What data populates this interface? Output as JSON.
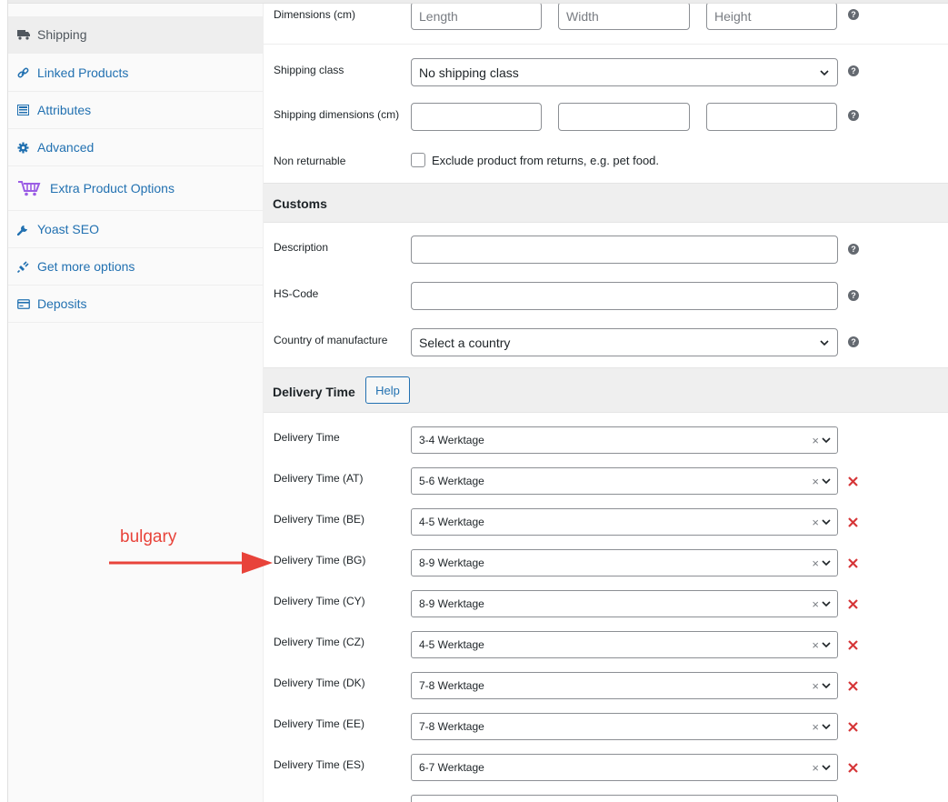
{
  "sidebar": {
    "items": [
      {
        "label": "Shipping",
        "icon": "truck-icon",
        "active": true
      },
      {
        "label": "Linked Products",
        "icon": "link-icon"
      },
      {
        "label": "Attributes",
        "icon": "list-icon"
      },
      {
        "label": "Advanced",
        "icon": "gear-icon"
      },
      {
        "label": "Extra Product Options",
        "icon": "cart-icon"
      },
      {
        "label": "Yoast SEO",
        "icon": "wrench-icon"
      },
      {
        "label": "Get more options",
        "icon": "plug-icon"
      },
      {
        "label": "Deposits",
        "icon": "card-icon"
      }
    ]
  },
  "shipping": {
    "dimensions_label": "Dimensions (cm)",
    "length_placeholder": "Length",
    "width_placeholder": "Width",
    "height_placeholder": "Height",
    "class_label": "Shipping class",
    "class_value": "No shipping class",
    "ship_dims_label": "Shipping dimensions (cm)",
    "non_returnable_label": "Non returnable",
    "non_returnable_text": "Exclude product from returns, e.g. pet food."
  },
  "customs": {
    "title": "Customs",
    "description_label": "Description",
    "hs_label": "HS-Code",
    "country_label": "Country of manufacture",
    "country_value": "Select a country"
  },
  "delivery": {
    "title": "Delivery Time",
    "help_label": "Help",
    "rows": [
      {
        "label": "Delivery Time",
        "value": "3-4 Werktage",
        "removable": false
      },
      {
        "label": "Delivery Time (AT)",
        "value": "5-6 Werktage",
        "removable": true
      },
      {
        "label": "Delivery Time (BE)",
        "value": "4-5 Werktage",
        "removable": true
      },
      {
        "label": "Delivery Time (BG)",
        "value": "8-9 Werktage",
        "removable": true
      },
      {
        "label": "Delivery Time (CY)",
        "value": "8-9 Werktage",
        "removable": true
      },
      {
        "label": "Delivery Time (CZ)",
        "value": "4-5 Werktage",
        "removable": true
      },
      {
        "label": "Delivery Time (DK)",
        "value": "7-8 Werktage",
        "removable": true
      },
      {
        "label": "Delivery Time (EE)",
        "value": "7-8 Werktage",
        "removable": true
      },
      {
        "label": "Delivery Time (ES)",
        "value": "6-7 Werktage",
        "removable": true
      }
    ],
    "clear_glyph": "×"
  },
  "annotation": {
    "text": "bulgary"
  },
  "colors": {
    "accent": "#2271b1",
    "remove": "#d63638",
    "annotation": "#e8433a",
    "extra_options": "#9b5de5"
  }
}
